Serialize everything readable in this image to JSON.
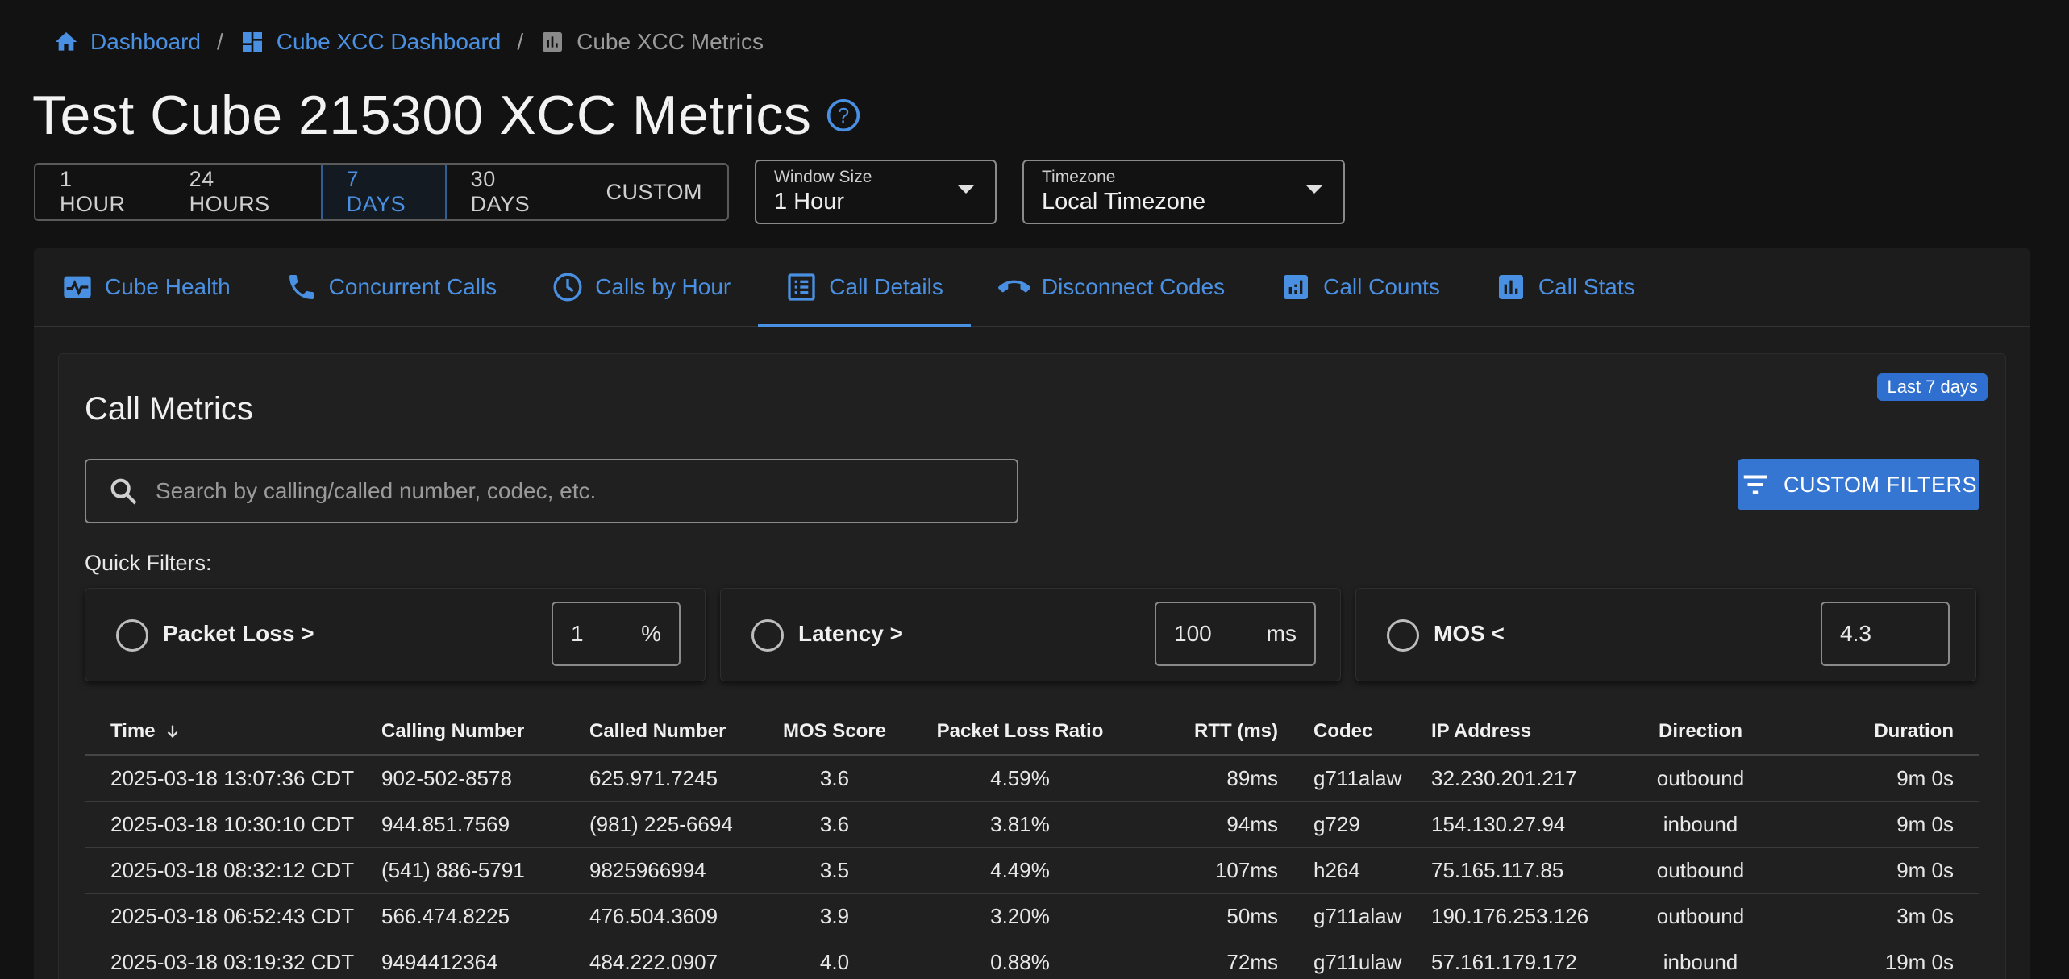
{
  "breadcrumb": {
    "items": [
      {
        "label": "Dashboard",
        "icon": "home-icon"
      },
      {
        "label": "Cube XCC Dashboard",
        "icon": "dashboard-icon"
      },
      {
        "label": "Cube XCC Metrics",
        "icon": "metrics-icon"
      }
    ],
    "separator": "/"
  },
  "page": {
    "title": "Test Cube 215300 XCC Metrics",
    "help_icon": "help-circle-icon"
  },
  "time_range": {
    "options": [
      "1 HOUR",
      "24 HOURS",
      "7 DAYS",
      "30 DAYS",
      "CUSTOM"
    ],
    "selected": "7 DAYS"
  },
  "window_size": {
    "label": "Window Size",
    "value": "1 Hour"
  },
  "timezone": {
    "label": "Timezone",
    "value": "Local Timezone"
  },
  "tabs": [
    {
      "label": "Cube Health",
      "icon": "pulse-icon"
    },
    {
      "label": "Concurrent Calls",
      "icon": "phone-icon"
    },
    {
      "label": "Calls by Hour",
      "icon": "clock-icon"
    },
    {
      "label": "Call Details",
      "icon": "list-icon"
    },
    {
      "label": "Disconnect Codes",
      "icon": "call-end-icon"
    },
    {
      "label": "Call Counts",
      "icon": "bar-chart-icon"
    },
    {
      "label": "Call Stats",
      "icon": "stats-icon"
    }
  ],
  "active_tab": "Call Details",
  "card": {
    "title": "Call Metrics",
    "badge": "Last 7 days",
    "search_placeholder": "Search by calling/called number, codec, etc.",
    "custom_filters_label": "CUSTOM FILTERS",
    "quick_filters_label": "Quick Filters:",
    "quick_filters": [
      {
        "label": "Packet Loss >",
        "value": "1",
        "unit": "%"
      },
      {
        "label": "Latency >",
        "value": "100",
        "unit": "ms"
      },
      {
        "label": "MOS <",
        "value": "4.3",
        "unit": ""
      }
    ]
  },
  "table": {
    "columns": [
      "Time",
      "Calling Number",
      "Called Number",
      "MOS Score",
      "Packet Loss Ratio",
      "RTT (ms)",
      "Codec",
      "IP Address",
      "Direction",
      "Duration"
    ],
    "sort_icon": "arrow-down-icon",
    "rows": [
      [
        "2025-03-18 13:07:36 CDT",
        "902-502-8578",
        "625.971.7245",
        "3.6",
        "4.59%",
        "89ms",
        "g711alaw",
        "32.230.201.217",
        "outbound",
        "9m 0s"
      ],
      [
        "2025-03-18 10:30:10 CDT",
        "944.851.7569",
        "(981) 225-6694",
        "3.6",
        "3.81%",
        "94ms",
        "g729",
        "154.130.27.94",
        "inbound",
        "9m 0s"
      ],
      [
        "2025-03-18 08:32:12 CDT",
        "(541) 886-5791",
        "9825966994",
        "3.5",
        "4.49%",
        "107ms",
        "h264",
        "75.165.117.85",
        "outbound",
        "9m 0s"
      ],
      [
        "2025-03-18 06:52:43 CDT",
        "566.474.8225",
        "476.504.3609",
        "3.9",
        "3.20%",
        "50ms",
        "g711alaw",
        "190.176.253.126",
        "outbound",
        "3m 0s"
      ],
      [
        "2025-03-18 03:19:32 CDT",
        "9494412364",
        "484.222.0907",
        "4.0",
        "0.88%",
        "72ms",
        "g711ulaw",
        "57.161.179.172",
        "inbound",
        "19m 0s"
      ]
    ]
  },
  "colors": {
    "accent": "#4a90e2",
    "button": "#3576d2",
    "background": "#121212",
    "panel": "#1c1c1c"
  }
}
